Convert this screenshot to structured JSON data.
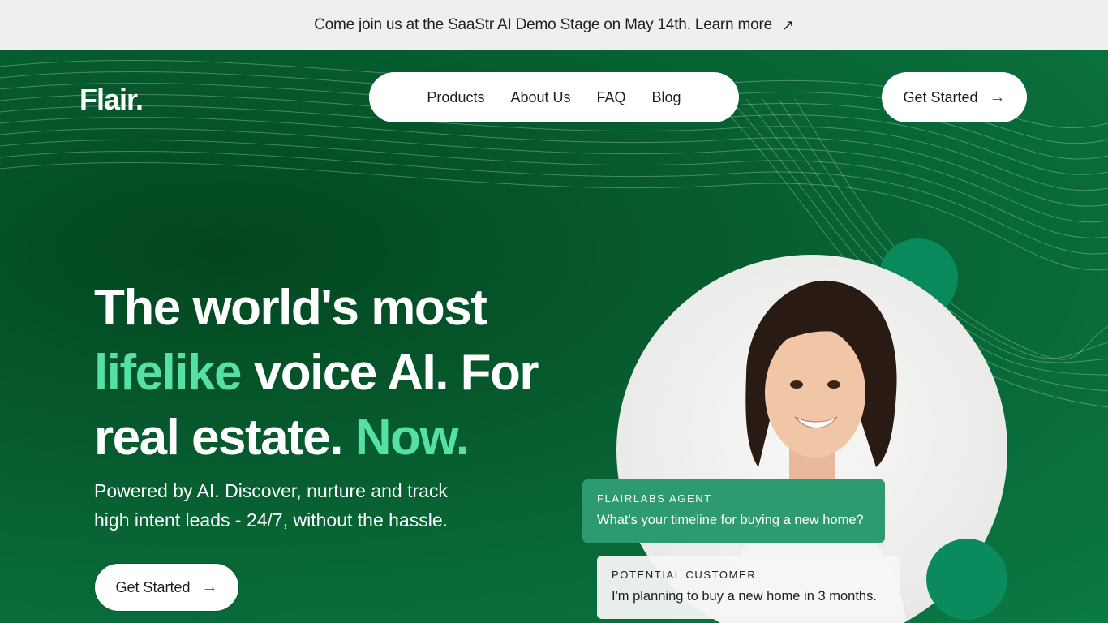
{
  "announcement": {
    "text": "Come join us at the SaaStr AI Demo Stage on May 14th. Learn more",
    "icon": "arrow-up-right-icon"
  },
  "brand": {
    "logo": "Flair."
  },
  "nav": {
    "items": [
      "Products",
      "About Us",
      "FAQ",
      "Blog"
    ]
  },
  "header": {
    "cta_label": "Get Started"
  },
  "hero": {
    "headline_1": "The world's most",
    "headline_accent_1": "lifelike",
    "headline_2": " voice AI. For",
    "headline_3": "real estate. ",
    "headline_accent_2": "Now.",
    "subtext_1": "Powered by AI. Discover, nurture and track",
    "subtext_2": "high intent leads - 24/7, without the hassle.",
    "cta_label": "Get Started"
  },
  "chat": {
    "agent_label": "FLAIRLABS AGENT",
    "agent_message": "What's your timeline for buying a new home?",
    "customer_label": "POTENTIAL CUSTOMER",
    "customer_message": "I'm planning to buy a new home in 3 months."
  },
  "colors": {
    "accent": "#57e0a6",
    "background": "#0a5a33",
    "bubble_agent": "#2e9a6f"
  }
}
